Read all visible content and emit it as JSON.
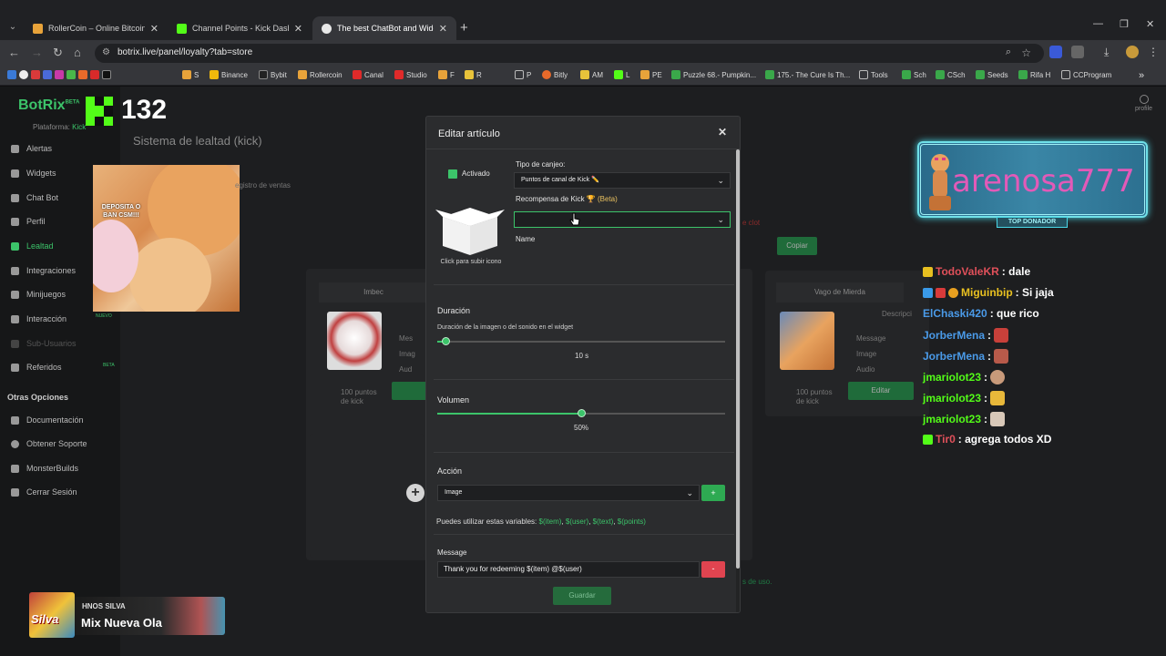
{
  "browser": {
    "tabs": [
      {
        "title": "RollerCoin – Online Bitcoin Min",
        "color": "#e8a33a"
      },
      {
        "title": "Channel Points - Kick Dashboa",
        "color": "#53fc18"
      },
      {
        "title": "The best ChatBot and Widgets",
        "color": "#e8e8e8"
      }
    ],
    "url": "botrix.live/panel/loyalty?tab=store",
    "bookmarks": [
      "S",
      "Binance",
      "Bybit",
      "Rollercoin",
      "Canal",
      "Studio",
      "F",
      "R",
      "P",
      "Bitly",
      "AM",
      "L",
      "PE",
      "Puzzle 68.- Pumpkin...",
      "175.- The Cure Is Th...",
      "Tools",
      "Sch",
      "CSch",
      "Seeds",
      "Rifa H",
      "CCProgram"
    ]
  },
  "app": {
    "brand": "BotRix",
    "brand_tag": "BETA",
    "platform_label": "Plataforma:",
    "platform_value": "Kick",
    "viewer_count": "132",
    "page_title": "Sistema de lealtad (kick)",
    "profile": "profile",
    "sidebar": [
      {
        "label": "Alertas"
      },
      {
        "label": "Widgets"
      },
      {
        "label": "Chat Bot"
      },
      {
        "label": "Perfil"
      },
      {
        "label": "Lealtad"
      },
      {
        "label": "Integraciones"
      },
      {
        "label": "Minijuegos"
      },
      {
        "label": "Interacción"
      },
      {
        "label": "Sub-Usuarios"
      },
      {
        "label": "Referidos"
      }
    ],
    "sidebar_section": "Otras Opciones",
    "sidebar_more": [
      {
        "label": "Documentación"
      },
      {
        "label": "Obtener Soporte"
      },
      {
        "label": "MonsterBuilds"
      },
      {
        "label": "Cerrar Sesión"
      }
    ],
    "meme_caption": "DEPOSITA O BAN CSM!!!",
    "meme_tag": "NUEVO",
    "referidos_tag": "BETA"
  },
  "background": {
    "tab_sales": "egistro de ventas",
    "copiar": "Copiar",
    "card1_title": "Imbec",
    "card2_title": "Vago de Mierda",
    "description": "Descripci",
    "card1_list": [
      "Mes",
      "Imag",
      "Aud"
    ],
    "card2_list": [
      "Message",
      "Image",
      "Audio"
    ],
    "points": "100 puntos de kick",
    "edit": "Editar",
    "red_text": "e clot",
    "green_text": "s de uso."
  },
  "modal": {
    "title": "Editar artículo",
    "activated": "Activado",
    "upload_icon": "Click para subir icono",
    "redeem_type_label": "Tipo de canjeo:",
    "redeem_type_value": "Puntos de canal de Kick ✏️",
    "reward_label": "Recompensa de Kick",
    "reward_beta": "🏆 (Beta)",
    "reward_value": "",
    "name_label": "Name",
    "duration_label": "Duración",
    "duration_help": "Duración de la imagen o del sonido en el widget",
    "duration_value": "10 s",
    "duration_fraction": 0.03,
    "volume_label": "Volumen",
    "volume_value": "50%",
    "volume_fraction": 0.5,
    "action_label": "Acción",
    "action_value": "Image",
    "action_add": "+",
    "vars_intro": "Puedes utilizar estas variables:",
    "vars": [
      "$(item)",
      "$(user)",
      "$(text)",
      "$(points)"
    ],
    "message_label": "Message",
    "message_value": "Thank you for redeeming $(item) @$(user)",
    "message_remove": "-",
    "save": "Guardar"
  },
  "overlay": {
    "top_donor_name": "arenosa777",
    "top_donor_label": "TOP DONADOR",
    "chat": [
      {
        "user": "TodoValeKR",
        "text": ": dale",
        "color": "#e0505a",
        "badge": "#e8c020"
      },
      {
        "user": "Miguinbip",
        "text": ": Si jaja",
        "color": "#e8c020",
        "badge": "#3a9ae8"
      },
      {
        "user": "ElChaski420",
        "text": ": que rico",
        "color": "#4a9ae8",
        "badge": ""
      },
      {
        "user": "JorberMena",
        "text": ":",
        "color": "#4a9ae8",
        "badge": ""
      },
      {
        "user": "JorberMena",
        "text": ":",
        "color": "#4a9ae8",
        "badge": ""
      },
      {
        "user": "jmariolot23",
        "text": ":",
        "color": "#53fc18",
        "badge": ""
      },
      {
        "user": "jmariolot23",
        "text": ":",
        "color": "#53fc18",
        "badge": ""
      },
      {
        "user": "jmariolot23",
        "text": ":",
        "color": "#53fc18",
        "badge": ""
      },
      {
        "user": "Tir0",
        "text": ": agrega todos XD",
        "color": "#e0505a",
        "badge": "#53fc18"
      }
    ],
    "music_artist": "HNOS SILVA",
    "music_title": "Mix Nueva Ola",
    "music_art_text": "Silva"
  }
}
